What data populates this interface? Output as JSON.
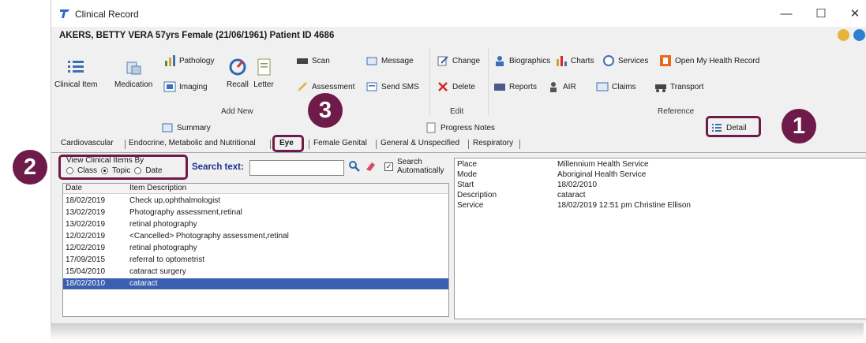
{
  "window": {
    "title": "Clinical Record",
    "minimize": "—",
    "maximize": "☐",
    "close": "✕"
  },
  "patient": {
    "header": "AKERS, BETTY VERA 57yrs Female (21/06/1961) Patient ID 4686"
  },
  "ribbon": {
    "add_new": {
      "label": "Add New",
      "clinical_item": "Clinical Item",
      "medication": "Medication",
      "pathology": "Pathology",
      "imaging": "Imaging",
      "recall": "Recall",
      "letter": "Letter",
      "scan": "Scan",
      "assessment": "Assessment",
      "message": "Message",
      "send_sms": "Send SMS"
    },
    "edit": {
      "label": "Edit",
      "change": "Change",
      "delete": "Delete"
    },
    "reference": {
      "label": "Reference",
      "biographics": "Biographics",
      "charts": "Charts",
      "services": "Services",
      "open_mhr": "Open My Health Record",
      "reports": "Reports",
      "air": "AIR",
      "claims": "Claims",
      "transport": "Transport"
    }
  },
  "views": {
    "summary": "Summary",
    "progress_notes": "Progress Notes",
    "detail": "Detail"
  },
  "tabs": [
    "Cardiovascular",
    "Endocrine, Metabolic and Nutritional",
    "Eye",
    "Female Genital",
    "General & Unspecified",
    "Respiratory"
  ],
  "filter": {
    "title": "View Clinical Items By",
    "options": [
      "Class",
      "Topic",
      "Date"
    ],
    "selected": "Topic",
    "search_label": "Search text:",
    "search_value": "",
    "search_auto": [
      "Search",
      "Automatically"
    ],
    "search_auto_checked": true
  },
  "list": {
    "headers": [
      "Date",
      "Item Description"
    ],
    "rows": [
      [
        "18/02/2019",
        "Check up,ophthalmologist"
      ],
      [
        "13/02/2019",
        "Photography assessment,retinal"
      ],
      [
        "13/02/2019",
        "retinal photography"
      ],
      [
        "12/02/2019",
        "<Cancelled> Photography assessment,retinal"
      ],
      [
        "12/02/2019",
        "retinal photography"
      ],
      [
        "17/09/2015",
        "referral to optometrist"
      ],
      [
        "15/04/2010",
        "cataract surgery"
      ],
      [
        "18/02/2010",
        "cataract"
      ]
    ],
    "selected_index": 7
  },
  "detail": [
    [
      "Place",
      "Millennium Health Service"
    ],
    [
      "Mode",
      "Aboriginal Health Service"
    ],
    [
      "Start",
      "18/02/2010"
    ],
    [
      "Description",
      "cataract"
    ],
    [
      "Service",
      "18/02/2019 12:51 pm Christine Ellison"
    ]
  ],
  "callouts": [
    "1",
    "2",
    "3"
  ],
  "colors": {
    "callout": "#6e1b4a",
    "selection": "#3b5fb0",
    "search_label": "#1f2f8f"
  }
}
